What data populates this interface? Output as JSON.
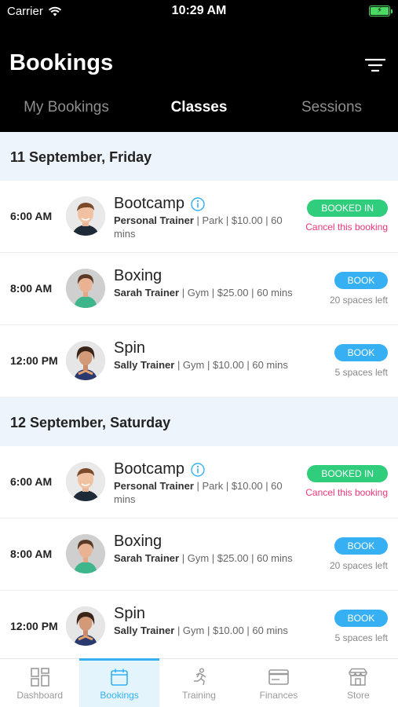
{
  "status_bar": {
    "carrier": "Carrier",
    "time": "10:29 AM"
  },
  "header": {
    "title": "Bookings"
  },
  "tabs": [
    {
      "label": "My Bookings",
      "active": false
    },
    {
      "label": "Classes",
      "active": true
    },
    {
      "label": "Sessions",
      "active": false
    }
  ],
  "days": [
    {
      "date": "11 September, Friday",
      "classes": [
        {
          "time": "6:00 AM",
          "name": "Bootcamp",
          "has_info": true,
          "trainer": "Personal Trainer",
          "details": " | Park | $10.00 | 60 mins",
          "button": "BOOKED IN",
          "sub": "Cancel this booking",
          "avatar": "man"
        },
        {
          "time": "8:00 AM",
          "name": "Boxing",
          "has_info": false,
          "trainer": "Sarah Trainer",
          "details": " | Gym | $25.00 | 60 mins",
          "button": "BOOK",
          "sub": "20 spaces left",
          "avatar": "woman1"
        },
        {
          "time": "12:00 PM",
          "name": "Spin",
          "has_info": false,
          "trainer": "Sally Trainer",
          "details": " | Gym | $10.00 | 60 mins",
          "button": "BOOK",
          "sub": "5 spaces left",
          "avatar": "woman2"
        }
      ]
    },
    {
      "date": "12 September, Saturday",
      "classes": [
        {
          "time": "6:00 AM",
          "name": "Bootcamp",
          "has_info": true,
          "trainer": "Personal Trainer",
          "details": " | Park | $10.00 | 60 mins",
          "button": "BOOKED IN",
          "sub": "Cancel this booking",
          "avatar": "man"
        },
        {
          "time": "8:00 AM",
          "name": "Boxing",
          "has_info": false,
          "trainer": "Sarah Trainer",
          "details": " | Gym | $25.00 | 60 mins",
          "button": "BOOK",
          "sub": "20 spaces left",
          "avatar": "woman1"
        },
        {
          "time": "12:00 PM",
          "name": "Spin",
          "has_info": false,
          "trainer": "Sally Trainer",
          "details": " | Gym | $10.00 | 60 mins",
          "button": "BOOK",
          "sub": "5 spaces left",
          "avatar": "woman2"
        }
      ]
    }
  ],
  "bottom_nav": [
    {
      "label": "Dashboard",
      "icon": "dashboard-icon",
      "active": false
    },
    {
      "label": "Bookings",
      "icon": "calendar-icon",
      "active": true
    },
    {
      "label": "Training",
      "icon": "running-icon",
      "active": false
    },
    {
      "label": "Finances",
      "icon": "credit-card-icon",
      "active": false
    },
    {
      "label": "Store",
      "icon": "store-icon",
      "active": false
    }
  ],
  "colors": {
    "accent": "#36b0f2",
    "booked": "#2fcd7c",
    "cancel": "#f0357a",
    "day_header_bg": "#eef4fb",
    "header_bg": "#000000"
  }
}
